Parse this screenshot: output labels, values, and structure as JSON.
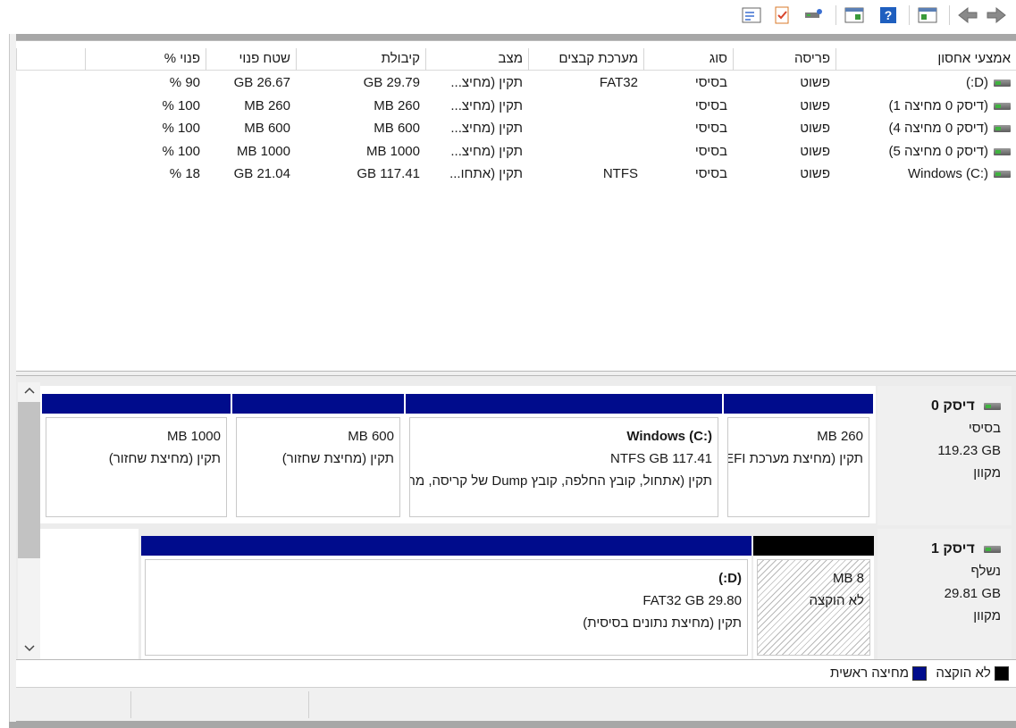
{
  "toolbar": {
    "buttons": [
      "back-arrow-icon",
      "forward-arrow-icon",
      "console-tree-icon",
      "help-icon",
      "action-pane-icon",
      "connect-drive-icon",
      "checklist-icon",
      "properties-icon"
    ]
  },
  "volumes": {
    "columns": [
      "אמצעי אחסון",
      "פריסה",
      "סוג",
      "מערכת קבצים",
      "מצב",
      "קיבולת",
      "שטח פנוי",
      "% פנוי"
    ],
    "rows": [
      {
        "name": "(D:)",
        "layout": "פשוט",
        "type": "בסיסי",
        "fs": "FAT32",
        "status": "תקין (מחיצ...",
        "capacity": "29.79 GB",
        "free": "26.67 GB",
        "pct": "90 %"
      },
      {
        "name": "(דיסק 0 מחיצה 1)",
        "layout": "פשוט",
        "type": "בסיסי",
        "fs": "",
        "status": "תקין (מחיצ...",
        "capacity": "260 MB",
        "free": "260 MB",
        "pct": "100 %"
      },
      {
        "name": "(דיסק 0 מחיצה 4)",
        "layout": "פשוט",
        "type": "בסיסי",
        "fs": "",
        "status": "תקין (מחיצ...",
        "capacity": "600 MB",
        "free": "600 MB",
        "pct": "100 %"
      },
      {
        "name": "(דיסק 0 מחיצה 5)",
        "layout": "פשוט",
        "type": "בסיסי",
        "fs": "",
        "status": "תקין (מחיצ...",
        "capacity": "1000 MB",
        "free": "1000 MB",
        "pct": "100 %"
      },
      {
        "name": "Windows (C:)",
        "layout": "פשוט",
        "type": "בסיסי",
        "fs": "NTFS",
        "status": "תקין (אתחו...",
        "capacity": "117.41 GB",
        "free": "21.04 GB",
        "pct": "18 %"
      }
    ]
  },
  "disks": [
    {
      "title": "דיסק 0",
      "kind": "בסיסי",
      "size": "119.23 GB",
      "state": "מקוון",
      "partitions": [
        {
          "name": "",
          "size": "260 MB",
          "status": "תקין (מחיצת מערכת EFI)"
        },
        {
          "name": "Windows  (C:)",
          "size": "117.41 NTFS GB",
          "status": "תקין (אתחול, קובץ החלפה, קובץ Dump של קריסה, מחיצה ראשית)"
        },
        {
          "name": "",
          "size": "600 MB",
          "status": "תקין (מחיצת שחזור)"
        },
        {
          "name": "",
          "size": "1000 MB",
          "status": "תקין (מחיצת שחזור)"
        }
      ]
    },
    {
      "title": "דיסק 1",
      "kind": "נשלף",
      "size": "29.81 GB",
      "state": "מקוון",
      "partitions": [
        {
          "name": "",
          "size": "8 MB",
          "status": "לא הוקצה"
        },
        {
          "name": "(D:)",
          "size": "29.80 FAT32 GB",
          "status": "תקין (מחיצת נתונים בסיסית)"
        }
      ]
    }
  ],
  "legend": {
    "unallocated": "לא הוקצה",
    "primary": "מחיצה ראשית"
  },
  "colors": {
    "primary_bar": "#000c8c",
    "unallocated_bar": "#000000"
  }
}
